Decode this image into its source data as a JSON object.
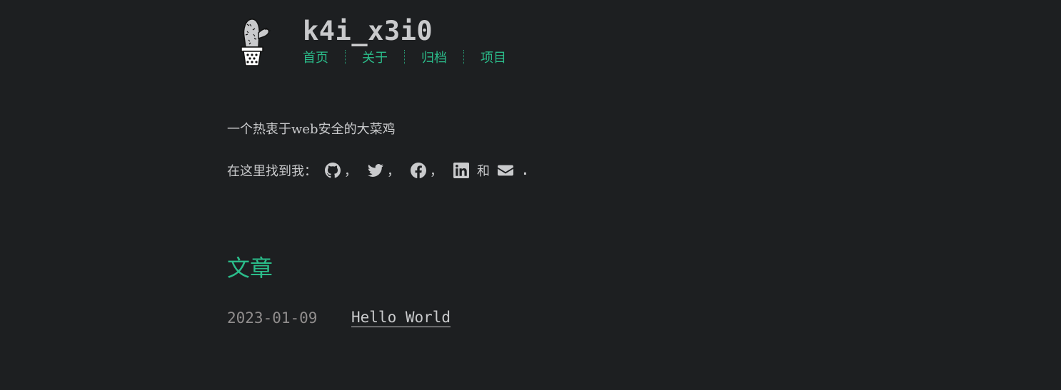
{
  "header": {
    "logo_icon": "cactus-logo",
    "title": "k4i_x3i0",
    "nav": [
      "首页",
      "关于",
      "归档",
      "项目"
    ]
  },
  "intro": {
    "bio": "一个热衷于web安全的大菜鸡",
    "find_me_label": "在这里找到我：",
    "social_icons": [
      "github-icon",
      "twitter-icon",
      "facebook-icon",
      "linkedin-icon",
      "envelope-icon"
    ],
    "comma": "，",
    "and": "和",
    "period": "."
  },
  "posts": {
    "heading": "文章",
    "items": [
      {
        "date": "2023-01-09",
        "title": "Hello World"
      }
    ]
  },
  "colors": {
    "background": "#1d1f21",
    "text": "#c9cacc",
    "accent": "#2bbc8a",
    "muted": "#908d8d"
  }
}
